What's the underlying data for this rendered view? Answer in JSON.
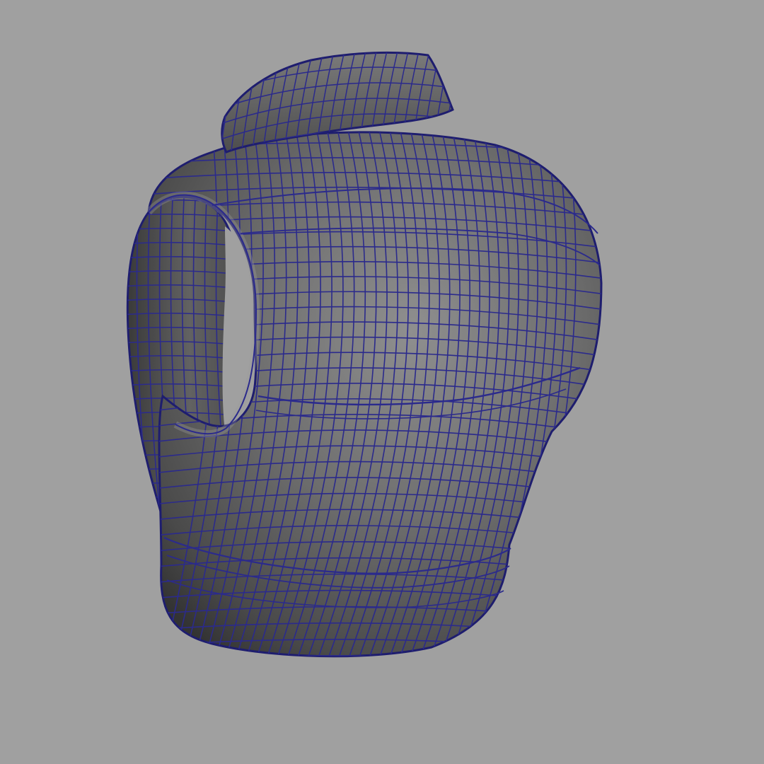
{
  "viewport": {
    "background_color": "#a0a0a0",
    "subject": "vest-mesh",
    "shading": "smooth-shaded-with-wireframe",
    "colors": {
      "mesh_light": "#8c8c8c",
      "mesh_mid": "#616161",
      "mesh_dark": "#2a2a2a",
      "wireframe": "#2b2a8c",
      "silhouette": "#1e1d6e"
    }
  }
}
